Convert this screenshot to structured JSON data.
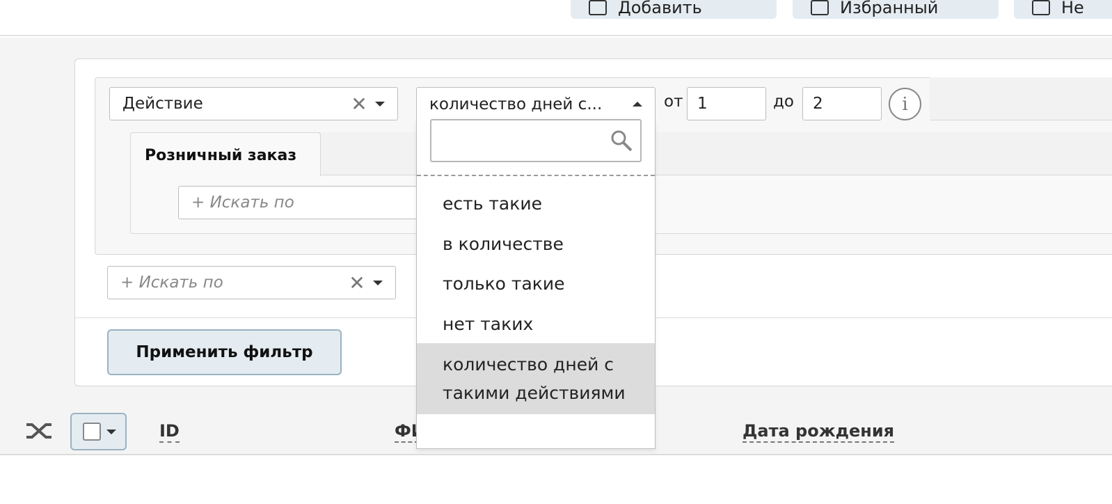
{
  "toolbar": {
    "buttons": [
      "Добавить",
      "Избранный",
      "Не"
    ]
  },
  "filter": {
    "action_select": {
      "value": "Действие"
    },
    "mode_select": {
      "value": "количество дней с..."
    },
    "range": {
      "from_label": "от",
      "from_value": "1",
      "to_label": "до",
      "to_value": "2"
    },
    "inner_tab_label": "Розничный заказ",
    "inner_search_placeholder": "+ Искать по",
    "outer_search_placeholder": "+ Искать по",
    "apply_label": "Применить фильтр"
  },
  "dropdown": {
    "search_value": "",
    "options": [
      "есть такие",
      "в количестве",
      "только такие",
      "нет таких",
      "количество дней с такими действиями"
    ],
    "selected_index": 4
  },
  "list_header": {
    "columns": [
      "ID",
      "ФИО",
      "Дата рождения"
    ]
  }
}
